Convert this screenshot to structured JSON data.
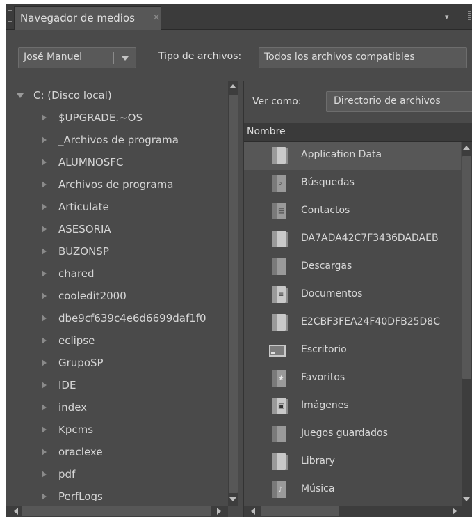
{
  "panel": {
    "tab_title": "Navegador de medios",
    "tab_close": "×",
    "menu_glyph": "▾"
  },
  "toolbar": {
    "user": "José Manuel",
    "file_type_label": "Tipo de archivos:",
    "file_type_value": "Todos los archivos compatibles"
  },
  "tree": {
    "root": "C: (Disco local)",
    "items": [
      "$UPGRADE.~OS",
      "_Archivos de programa",
      "ALUMNOSFC",
      "Archivos de programa",
      "Articulate",
      "ASESORIA",
      "BUZONSP",
      "chared",
      "cooledit2000",
      "dbe9cf639c4e6d6699daf1f0",
      "eclipse",
      "GrupoSP",
      "IDE",
      "index",
      "Kpcms",
      "oraclexe",
      "pdf",
      "PerfLogs"
    ]
  },
  "browser": {
    "view_as_label": "Ver como:",
    "view_as_value": "Directorio de archivos",
    "column_name": "Nombre",
    "items": [
      {
        "label": "Application Data",
        "icon": "folder-icon",
        "selected": true
      },
      {
        "label": "Búsquedas",
        "icon": "search-folder-icon"
      },
      {
        "label": "Contactos",
        "icon": "contacts-folder-icon"
      },
      {
        "label": "DA7ADA42C7F3436DADAEB",
        "icon": "folder-icon"
      },
      {
        "label": "Descargas",
        "icon": "downloads-folder-icon"
      },
      {
        "label": "Documentos",
        "icon": "documents-folder-icon"
      },
      {
        "label": "E2CBF3FEA24F40DFB25D8C",
        "icon": "folder-icon"
      },
      {
        "label": "Escritorio",
        "icon": "desktop-icon"
      },
      {
        "label": "Favoritos",
        "icon": "favorites-folder-icon"
      },
      {
        "label": "Imágenes",
        "icon": "pictures-folder-icon"
      },
      {
        "label": "Juegos guardados",
        "icon": "saved-games-folder-icon"
      },
      {
        "label": "Library",
        "icon": "folder-icon"
      },
      {
        "label": "Música",
        "icon": "music-folder-icon"
      }
    ]
  }
}
